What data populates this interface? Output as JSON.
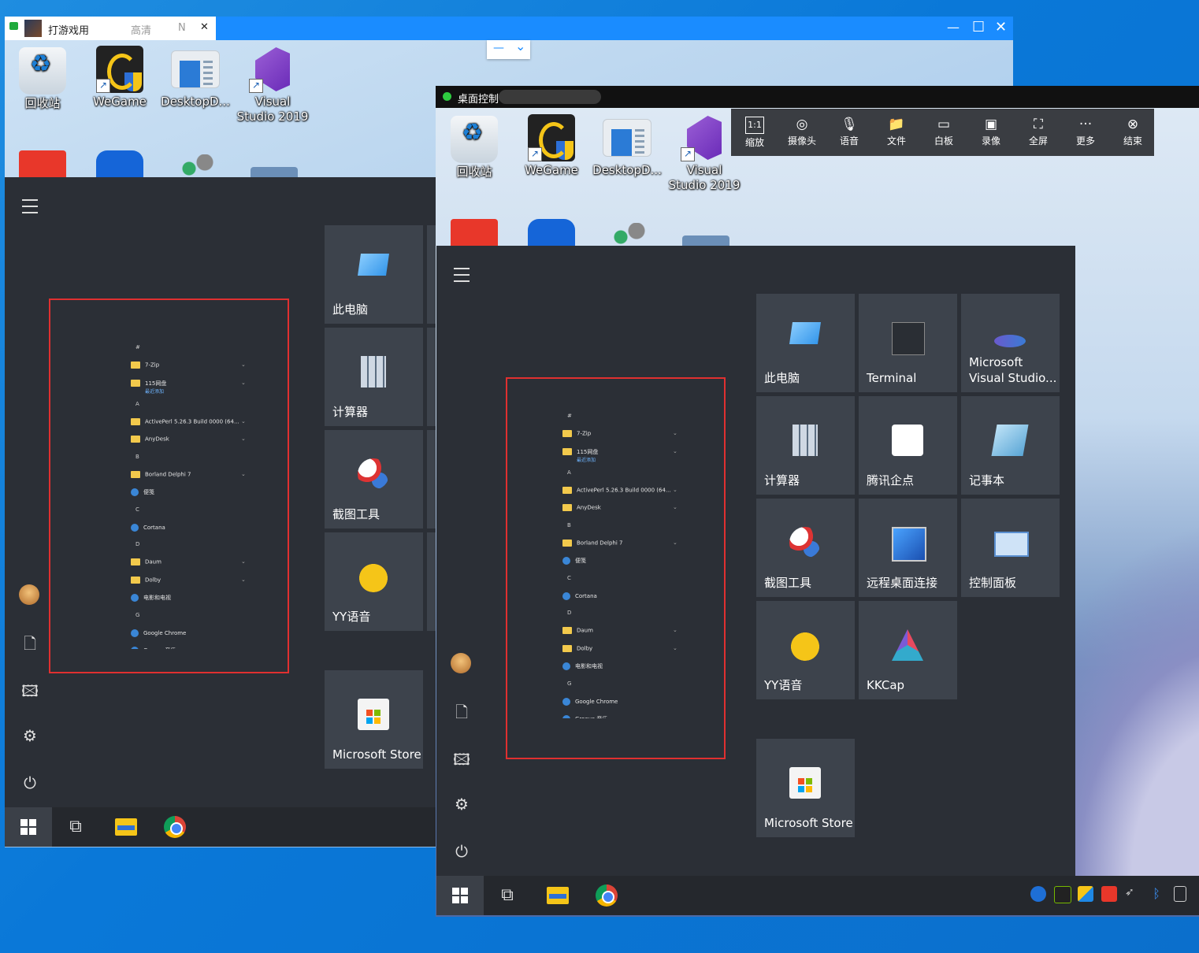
{
  "left_window": {
    "tab_title": "打游戏用",
    "tab_quality": "高清",
    "tab_extra": "N",
    "minimize": "—",
    "maximize": "☐",
    "close": "✕"
  },
  "floating_control": {
    "minus": "—",
    "chevron": "⌄"
  },
  "right_window": {
    "title": "桌面控制"
  },
  "desktop_icons": [
    {
      "label": "回收站",
      "icon": "recycle-bin-icon"
    },
    {
      "label": "WeGame",
      "icon": "wegame-icon"
    },
    {
      "label": "DesktopD...",
      "icon": "desktop-icon"
    },
    {
      "label": "Visual Studio 2019",
      "icon": "visual-studio-icon"
    }
  ],
  "toolbar": [
    {
      "label": "缩放",
      "icon": "1:1"
    },
    {
      "label": "摄像头",
      "icon": "◎"
    },
    {
      "label": "语音",
      "icon": "🎙"
    },
    {
      "label": "文件",
      "icon": "📁"
    },
    {
      "label": "白板",
      "icon": "▭"
    },
    {
      "label": "录像",
      "icon": "▣"
    },
    {
      "label": "全屏",
      "icon": "⛶"
    },
    {
      "label": "更多",
      "icon": "···"
    },
    {
      "label": "结束",
      "icon": "⊗"
    }
  ],
  "app_list": {
    "items": [
      {
        "type": "header",
        "text": "#"
      },
      {
        "type": "folder",
        "text": "7-Zip",
        "chev": "⌄"
      },
      {
        "type": "folder",
        "text": "115网盘",
        "sub": "最近添加",
        "chev": "⌄"
      },
      {
        "type": "header",
        "text": "A"
      },
      {
        "type": "folder",
        "text": "ActivePerl 5.26.3 Build 0000 (64...",
        "chev": "⌄"
      },
      {
        "type": "folder",
        "text": "AnyDesk",
        "chev": "⌄"
      },
      {
        "type": "header",
        "text": "B"
      },
      {
        "type": "folder",
        "text": "Borland Delphi 7",
        "chev": "⌄"
      },
      {
        "type": "app",
        "text": "便笺"
      },
      {
        "type": "header",
        "text": "C"
      },
      {
        "type": "app",
        "text": "Cortana"
      },
      {
        "type": "header",
        "text": "D"
      },
      {
        "type": "folder",
        "text": "Daum",
        "chev": "⌄"
      },
      {
        "type": "folder",
        "text": "Dolby",
        "chev": "⌄"
      },
      {
        "type": "app",
        "text": "电影和电视"
      },
      {
        "type": "header",
        "text": "G"
      },
      {
        "type": "app",
        "text": "Google Chrome"
      },
      {
        "type": "app",
        "text": "Groove 音乐"
      }
    ]
  },
  "left_tiles": [
    {
      "label": "此电脑"
    },
    {
      "label": "计算器"
    },
    {
      "label": "截图工具"
    },
    {
      "label": "YY语音"
    },
    {
      "label": "Microsoft Store"
    }
  ],
  "right_tiles": [
    {
      "label": "此电脑"
    },
    {
      "label": "Terminal"
    },
    {
      "label": "Microsoft\nVisual Studio..."
    },
    {
      "label": "计算器"
    },
    {
      "label": "腾讯企点"
    },
    {
      "label": "记事本"
    },
    {
      "label": "截图工具"
    },
    {
      "label": "远程桌面连接"
    },
    {
      "label": "控制面板"
    },
    {
      "label": "YY语音"
    },
    {
      "label": "KKCap"
    },
    {
      "label": "Microsoft Store"
    }
  ],
  "colors": {
    "accent": "#1a8cff",
    "redbox": "#e03030",
    "tile": "#3d434c",
    "start_bg": "#2b2f36"
  }
}
